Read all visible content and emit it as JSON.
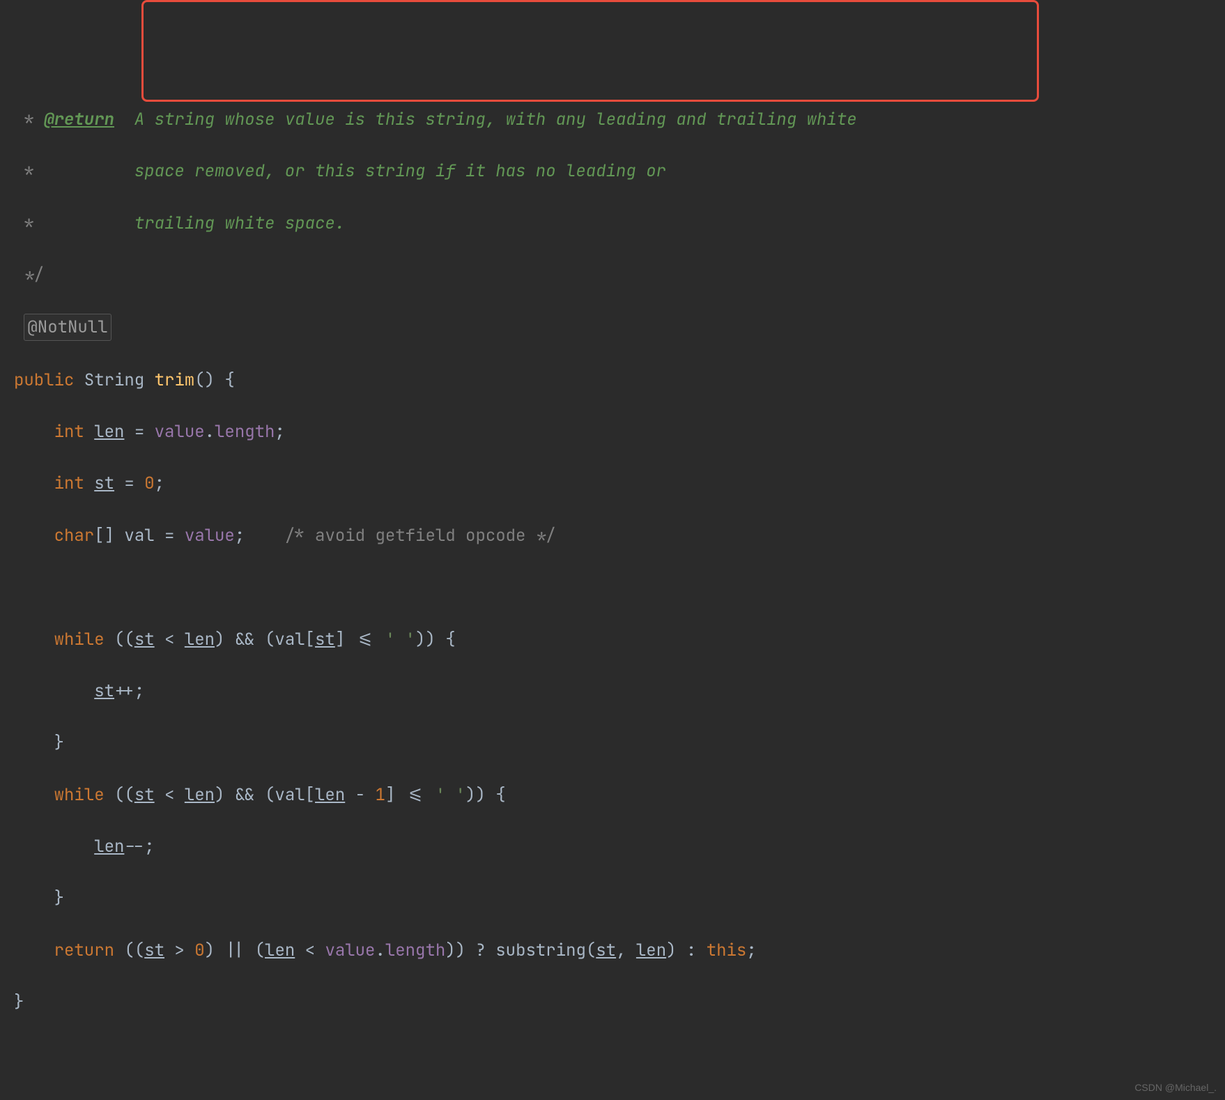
{
  "javadoc": {
    "star1": " * ",
    "tag": "@return",
    "desc1_space": "  ",
    "desc1": "A string whose value is this string, with any leading and trailing white",
    "star2": " *          ",
    "desc2": "space removed, or this string if it has no leading or",
    "star3": " *          ",
    "desc3": "trailing white space.",
    "close": " */"
  },
  "annotation": "@NotNull",
  "sig": {
    "pre": "public",
    "type": " String ",
    "name": "trim",
    "post": "() {"
  },
  "line1": {
    "indent": "    ",
    "kw": "int",
    "sp1": " ",
    "v": "len",
    "sp2": " = ",
    "f": "value",
    "dot": ".",
    "p": "length",
    "semi": ";"
  },
  "line2": {
    "indent": "    ",
    "kw": "int",
    "sp1": " ",
    "v": "st",
    "sp2": " = ",
    "n": "0",
    "semi": ";"
  },
  "line3": {
    "indent": "    ",
    "kw": "char",
    "br": "[] ",
    "v": "val",
    "eq": " = ",
    "f": "value",
    "semi": ";",
    "sp": "    ",
    "c": "/* avoid getfield opcode */"
  },
  "while1": {
    "indent": "    ",
    "kw": "while",
    "open": " ((",
    "st": "st",
    "lt": " < ",
    "len": "len",
    "mid": ") && (val[",
    "st2": "st",
    "close": "] <= ",
    "str": "' '",
    "end": ")) {"
  },
  "stinc": {
    "indent": "        ",
    "st": "st",
    "op": "++;"
  },
  "brace1": {
    "indent": "    ",
    "t": "}"
  },
  "while2": {
    "indent": "    ",
    "kw": "while",
    "open": " ((",
    "st": "st",
    "lt": " < ",
    "len": "len",
    "mid": ") && (val[",
    "len2": "len",
    "minus": " - ",
    "one": "1",
    "close": "] <= ",
    "str": "' '",
    "end": ")) {"
  },
  "lendec": {
    "indent": "        ",
    "len": "len",
    "op": "--;"
  },
  "brace2": {
    "indent": "    ",
    "t": "}"
  },
  "ret": {
    "indent": "    ",
    "kw": "return",
    "open": " ((",
    "st": "st",
    "gt": " > ",
    "z": "0",
    "or": ") || (",
    "len": "len",
    "lt": " < ",
    "f": "value",
    "dot": ".",
    "p": "length",
    "mid": ")) ? ",
    "sub": "substring",
    "p1": "(",
    "st2": "st",
    "cm": ", ",
    "len2": "len",
    "p2": ") : ",
    "this": "this",
    "semi": ";"
  },
  "closeBrace": "}",
  "watermark": "CSDN @Michael_."
}
